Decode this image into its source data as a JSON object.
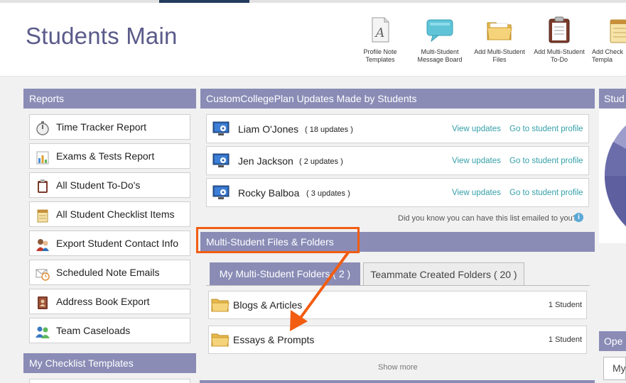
{
  "page": {
    "title": "Students Main"
  },
  "toolbar": [
    {
      "label": "Profile Note Templates",
      "icon": "profile-note-templates-icon"
    },
    {
      "label": "Multi-Student Message Board",
      "icon": "message-board-icon"
    },
    {
      "label": "Add Multi-Student Files",
      "icon": "folder-icon"
    },
    {
      "label": "Add Multi-Student To-Do",
      "icon": "clipboard-icon"
    },
    {
      "label": "Add Check Templa",
      "icon": "checklist-icon"
    }
  ],
  "reports": {
    "heading": "Reports",
    "items": [
      {
        "label": "Time Tracker Report",
        "icon": "stopwatch-icon"
      },
      {
        "label": "Exams & Tests Report",
        "icon": "bar-chart-icon"
      },
      {
        "label": "All Student To-Do's",
        "icon": "clipboard-icon"
      },
      {
        "label": "All Student Checklist Items",
        "icon": "notepad-icon"
      },
      {
        "label": "Export Student Contact Info",
        "icon": "contacts-icon"
      },
      {
        "label": "Scheduled Note Emails",
        "icon": "scheduled-email-icon"
      },
      {
        "label": "Address Book Export",
        "icon": "address-book-icon"
      },
      {
        "label": "Team Caseloads",
        "icon": "team-icon"
      }
    ]
  },
  "checklist_templates": {
    "heading": "My Checklist Templates"
  },
  "updates": {
    "heading": "CustomCollegePlan Updates Made by Students",
    "rows": [
      {
        "name": "Liam O'Jones",
        "count": "( 18 updates )",
        "view": "View updates",
        "profile": "Go to student profile"
      },
      {
        "name": "Jen Jackson",
        "count": "( 2 updates )",
        "view": "View updates",
        "profile": "Go to student profile"
      },
      {
        "name": "Rocky Balboa",
        "count": "( 3 updates )",
        "view": "View updates",
        "profile": "Go to student profile"
      }
    ],
    "note": "Did you know you can have this list emailed to you?"
  },
  "files": {
    "heading": "Multi-Student Files & Folders",
    "tabs": [
      {
        "label": "My Multi-Student Folders ( 2 )",
        "active": true
      },
      {
        "label": "Teammate Created Folders ( 20 )",
        "active": false
      }
    ],
    "folders": [
      {
        "name": "Blogs & Articles",
        "count": "1 Student"
      },
      {
        "name": "Essays & Prompts",
        "count": "1 Student"
      }
    ],
    "show_more": "Show more"
  },
  "right_column": {
    "heading": "Stud",
    "heading2": "Ope",
    "tab": "My"
  },
  "colors": {
    "panel_header": "#8a8cb6",
    "link": "#35a0a8",
    "highlight": "#f25d12",
    "title": "#5a5a8a"
  }
}
